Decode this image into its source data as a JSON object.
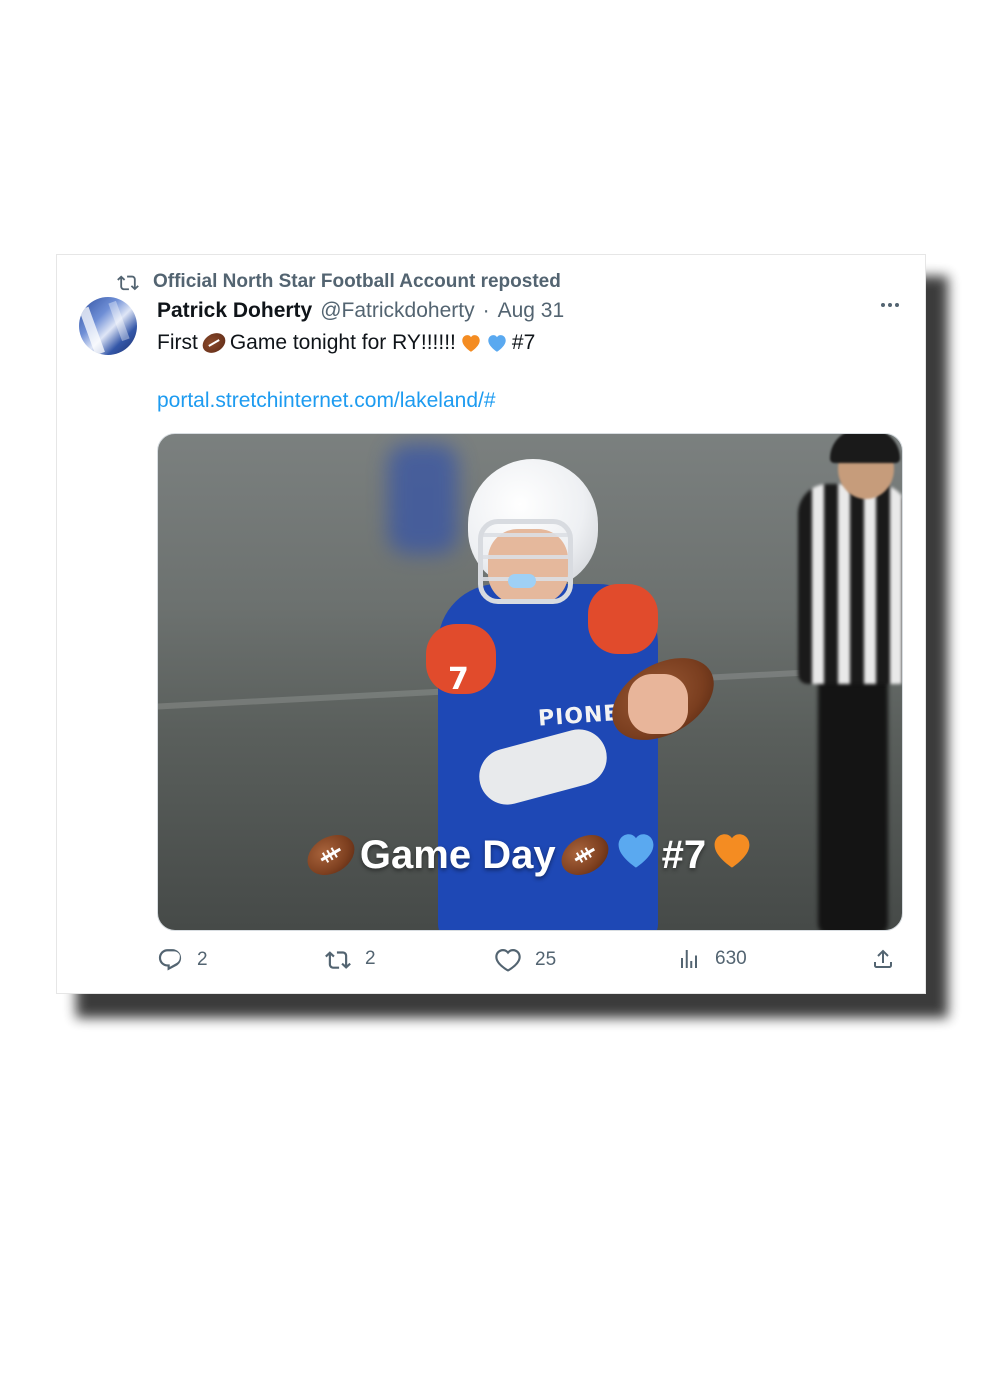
{
  "repost": {
    "label": "Official North Star Football Account reposted"
  },
  "tweet": {
    "author_name": "Patrick Doherty",
    "author_handle": "@Fatrickdoherty",
    "separator": "·",
    "date": "Aug 31",
    "text_part1": "First",
    "text_part2": "Game tonight for RY!!!!!!",
    "text_part3": "#7",
    "link": "portal.stretchinternet.com/lakeland/#"
  },
  "media": {
    "caption_text": "Game Day",
    "caption_number": "#7",
    "jersey_number": "7",
    "jersey_text": "PIONEERS"
  },
  "stats": {
    "replies": "2",
    "reposts": "2",
    "likes": "25",
    "views": "630"
  },
  "colors": {
    "accent_link": "#1d9bf0",
    "muted_text": "#536471",
    "heart_orange": "#f48c22",
    "heart_blue": "#5aa9f0"
  },
  "icons": {
    "repost": "repost-icon",
    "more": "more-icon",
    "reply": "reply-icon",
    "like": "heart-icon",
    "views": "views-icon",
    "share": "share-icon"
  }
}
